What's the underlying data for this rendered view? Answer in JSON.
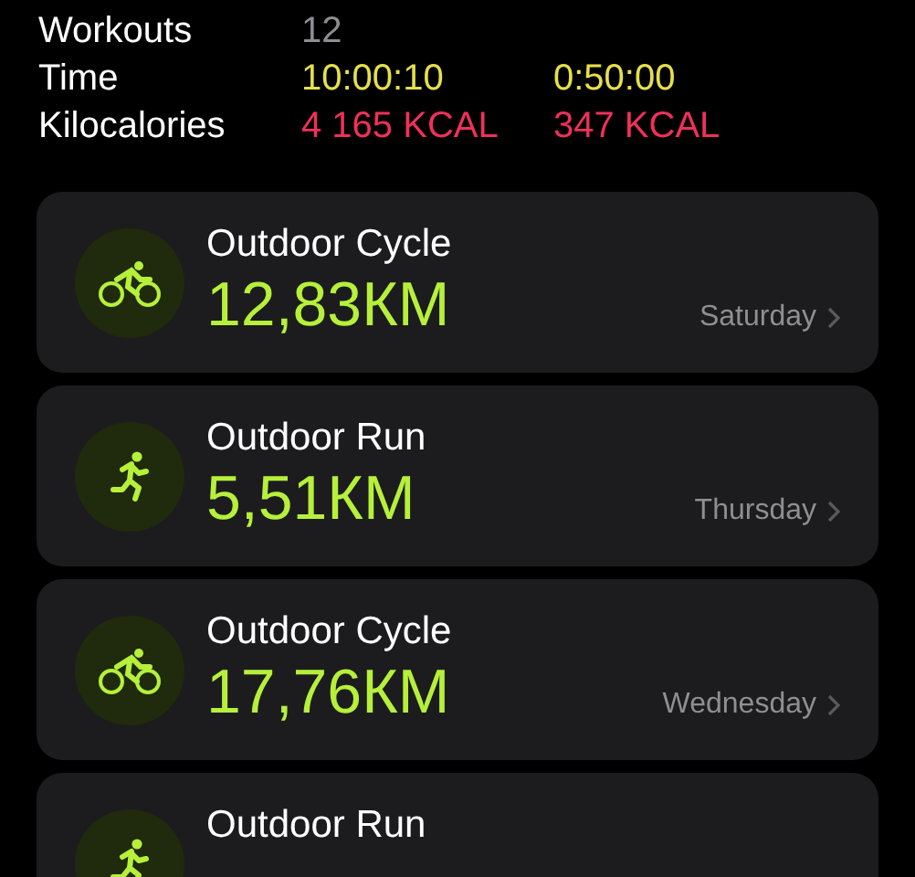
{
  "summary": [
    {
      "label": "Workouts",
      "values": [
        {
          "text": "12",
          "kind": "count"
        }
      ]
    },
    {
      "label": "Time",
      "values": [
        {
          "text": "10:00:10",
          "kind": "time"
        },
        {
          "text": "0:50:00",
          "kind": "time"
        }
      ]
    },
    {
      "label": "Kilocalories",
      "values": [
        {
          "text": "4 165 KCAL",
          "kind": "energy"
        },
        {
          "text": "347 KCAL",
          "kind": "energy"
        }
      ]
    }
  ],
  "workouts": [
    {
      "kind": "cycle",
      "title": "Outdoor Cycle",
      "distance": "12,83КМ",
      "day": "Saturday"
    },
    {
      "kind": "run",
      "title": "Outdoor Run",
      "distance": "5,51КМ",
      "day": "Thursday"
    },
    {
      "kind": "cycle",
      "title": "Outdoor Cycle",
      "distance": "17,76КМ",
      "day": "Wednesday"
    },
    {
      "kind": "run",
      "title": "Outdoor Run"
    }
  ]
}
